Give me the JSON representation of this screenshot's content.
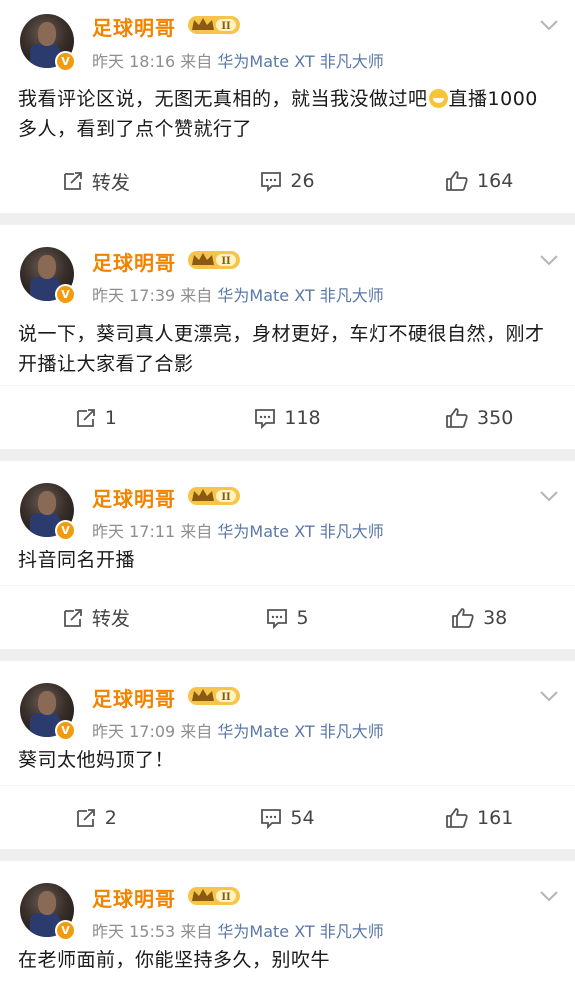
{
  "posts": [
    {
      "user": "足球明哥",
      "badge_level": "II",
      "time": "昨天 18:16",
      "source_prefix": "来自",
      "device": "华为Mate XT 非凡大师",
      "content_part1": "我看评论区说，无图无真相的，就当我没做过吧",
      "content_part2": "直播1000多人，看到了点个赞就行了",
      "has_emoji": true,
      "repost": "转发",
      "comments": "26",
      "likes": "164"
    },
    {
      "user": "足球明哥",
      "badge_level": "II",
      "time": "昨天 17:39",
      "source_prefix": "来自",
      "device": "华为Mate XT 非凡大师",
      "content_part1": "说一下，葵司真人更漂亮，身材更好，车灯不硬很自然，刚才开播让大家看了合影",
      "content_part2": "",
      "has_emoji": false,
      "repost": "1",
      "comments": "118",
      "likes": "350"
    },
    {
      "user": "足球明哥",
      "badge_level": "II",
      "time": "昨天 17:11",
      "source_prefix": "来自",
      "device": "华为Mate XT 非凡大师",
      "content_part1": "抖音同名开播",
      "content_part2": "",
      "has_emoji": false,
      "repost": "转发",
      "comments": "5",
      "likes": "38"
    },
    {
      "user": "足球明哥",
      "badge_level": "II",
      "time": "昨天 17:09",
      "source_prefix": "来自",
      "device": "华为Mate XT 非凡大师",
      "content_part1": "葵司太他妈顶了！",
      "content_part2": "",
      "has_emoji": false,
      "repost": "2",
      "comments": "54",
      "likes": "161"
    },
    {
      "user": "足球明哥",
      "badge_level": "II",
      "time": "昨天 15:53",
      "source_prefix": "来自",
      "device": "华为Mate XT 非凡大师",
      "content_part1": "在老师面前，你能坚持多久，别吹牛",
      "content_part2": "",
      "has_emoji": false,
      "repost": "",
      "comments": "",
      "likes": ""
    }
  ],
  "icons": {
    "verified": "verified-v-icon",
    "crown": "crown-badge-icon",
    "more": "chevron-down-icon",
    "repost": "repost-icon",
    "comment": "comment-icon",
    "like": "thumbs-up-icon"
  },
  "colors": {
    "username": "#f08300",
    "device": "#5a78a8",
    "meta": "#8e8e8e",
    "verified": "#f29b0f"
  }
}
